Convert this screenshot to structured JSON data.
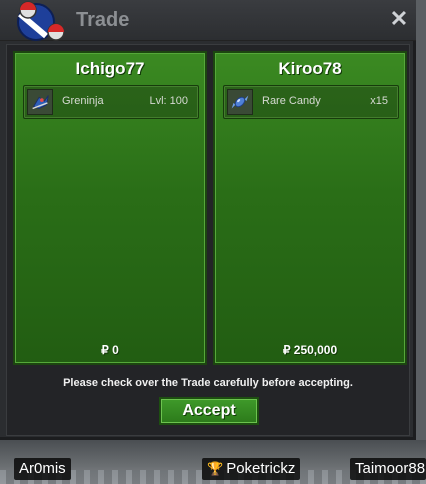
{
  "window": {
    "title": "Trade",
    "close_glyph": "✕"
  },
  "trade": {
    "left": {
      "player": "Ichigo77",
      "item": {
        "icon": "greninja-icon",
        "name": "Greninja",
        "extra": "Lvl: 100"
      },
      "money": "₽ 0"
    },
    "right": {
      "player": "Kiroo78",
      "item": {
        "icon": "rare-candy-icon",
        "name": "Rare Candy",
        "extra": "x15"
      },
      "money": "₽ 250,000"
    },
    "notice": "Please check over the Trade carefully before accepting.",
    "accept_label": "Accept"
  },
  "nametags": [
    {
      "name": "Ar0mis"
    },
    {
      "name": "Poketrickz",
      "icon": "trophy-icon"
    },
    {
      "name": "Taimoor88"
    }
  ],
  "colors": {
    "panel_green": "#2a6e17",
    "accept_green": "#2c7a1a",
    "window_dark": "#2b2d30"
  }
}
